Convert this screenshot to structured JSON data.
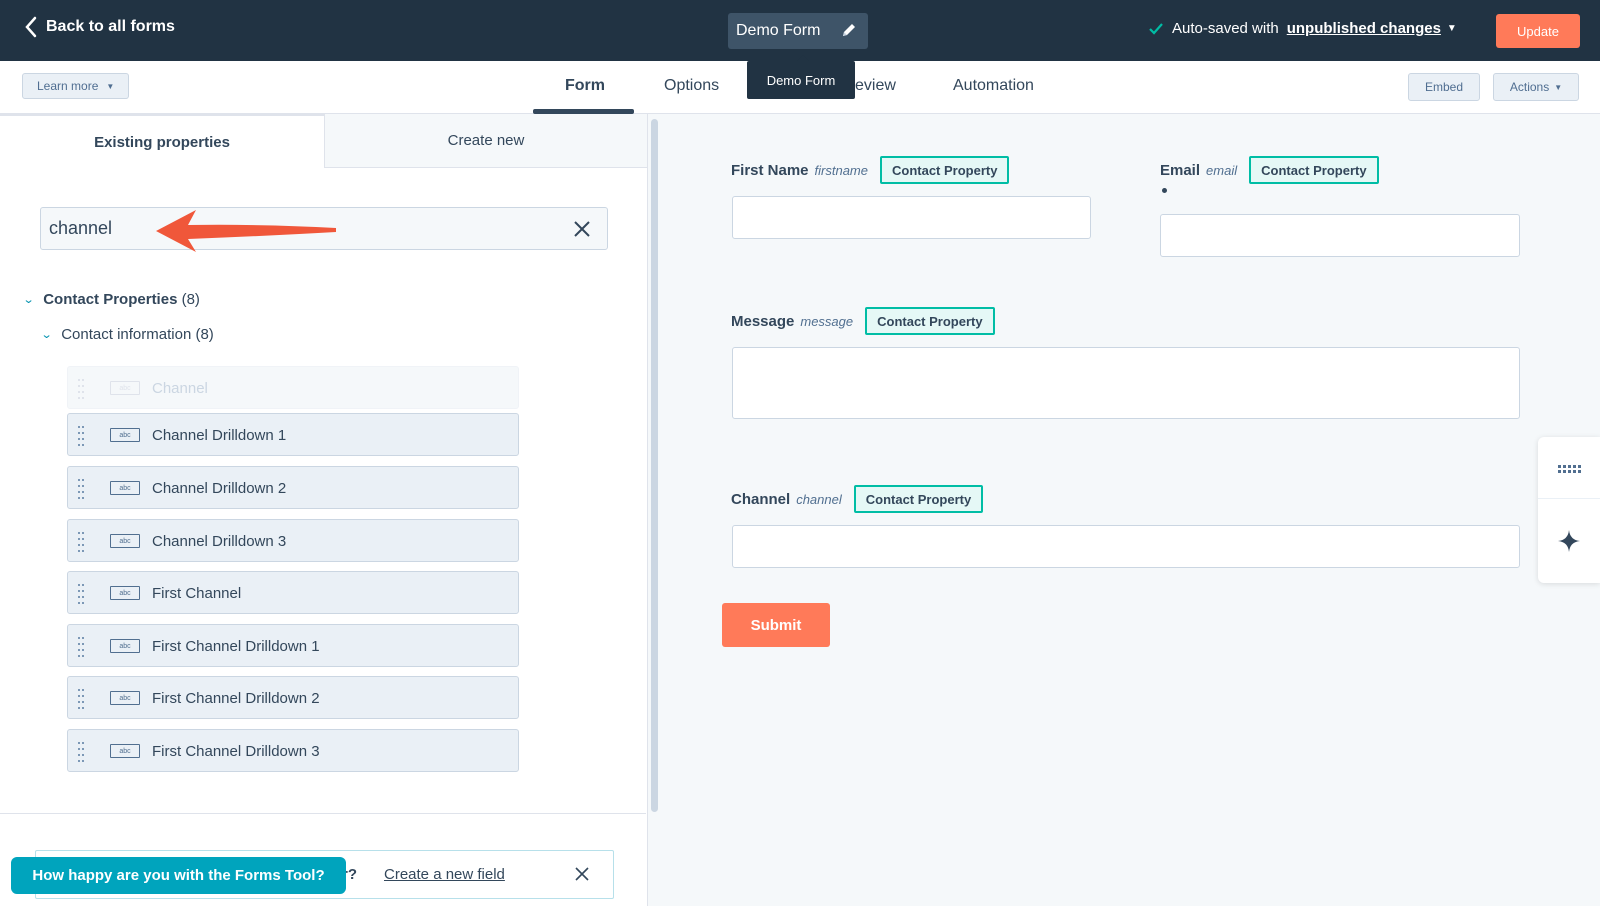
{
  "topbar": {
    "back_label": "Back to all forms",
    "form_name": "Demo Form",
    "tooltip": "Demo Form",
    "autosave_prefix": "Auto-saved with",
    "autosave_link": "unpublished changes",
    "update_label": "Update"
  },
  "subnav": {
    "learn_more": "Learn more",
    "tabs": [
      {
        "label": "Form",
        "active": true
      },
      {
        "label": "Options"
      },
      {
        "label": "eview"
      },
      {
        "label": "Automation"
      }
    ],
    "embed": "Embed",
    "actions": "Actions"
  },
  "left_panel": {
    "tabs": [
      "Existing properties",
      "Create new"
    ],
    "search_value": "channel",
    "group": {
      "name": "Contact Properties",
      "count": "(8)"
    },
    "subgroup": {
      "label": "Contact information (8)"
    },
    "icon_text": "abc",
    "items": [
      {
        "label": "Channel",
        "disabled": true
      },
      {
        "label": "Channel Drilldown 1"
      },
      {
        "label": "Channel Drilldown 2"
      },
      {
        "label": "Channel Drilldown 3"
      },
      {
        "label": "First Channel"
      },
      {
        "label": "First Channel Drilldown 1"
      },
      {
        "label": "First Channel Drilldown 2"
      },
      {
        "label": "First Channel Drilldown 3"
      }
    ],
    "hint_question_tail": "r?",
    "hint_link": "Create a new field",
    "feedback": "How happy are you with the Forms Tool?"
  },
  "canvas": {
    "tag_label": "Contact Property",
    "fields": [
      {
        "label": "First Name",
        "internal": "firstname"
      },
      {
        "label": "Email",
        "internal": "email"
      },
      {
        "label": "Message",
        "internal": "message"
      },
      {
        "label": "Channel",
        "internal": "channel"
      }
    ],
    "submit": "Submit"
  },
  "colors": {
    "topbar": "#213343",
    "accent": "#ff7a59",
    "tag_border": "#00bda5",
    "feedback": "#00a4bd"
  }
}
